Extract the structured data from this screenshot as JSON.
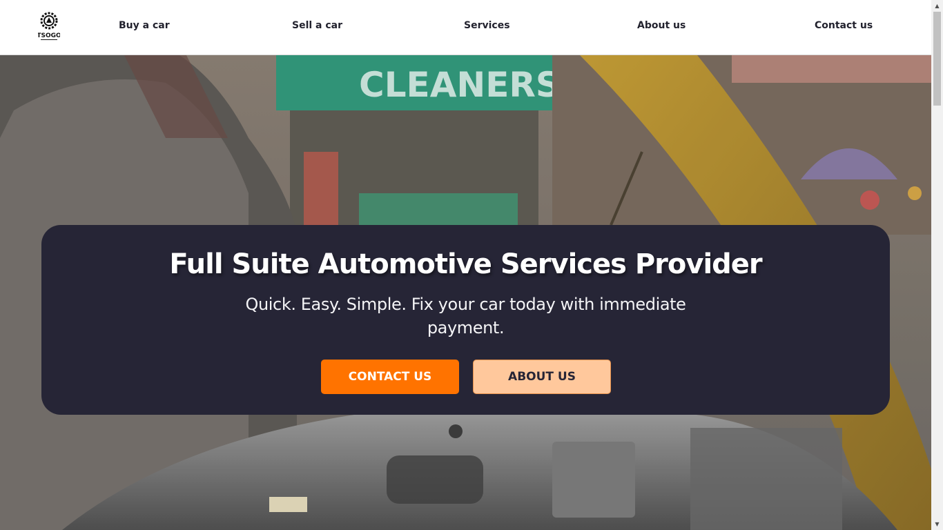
{
  "brand": {
    "logo_text": "TSOGO",
    "logo_icon": "gear-wheel-icon"
  },
  "nav": {
    "buy": "Buy a car",
    "sell": "Sell a car",
    "services": "Services",
    "about": "About us",
    "contact": "Contact us"
  },
  "hero": {
    "title": "Full Suite Automotive Services Provider",
    "subtitle": "Quick. Easy. Simple. Fix your car today with immediate payment.",
    "primary_button": "CONTACT US",
    "secondary_button": "ABOUT US",
    "background_sign": "CLEANERS"
  },
  "colors": {
    "card": "#262536",
    "primary": "#ff7300",
    "secondary": "#ffc89c",
    "nav_text": "#22222e"
  },
  "scrollbar": {
    "up_icon": "▲",
    "down_icon": "▼"
  }
}
